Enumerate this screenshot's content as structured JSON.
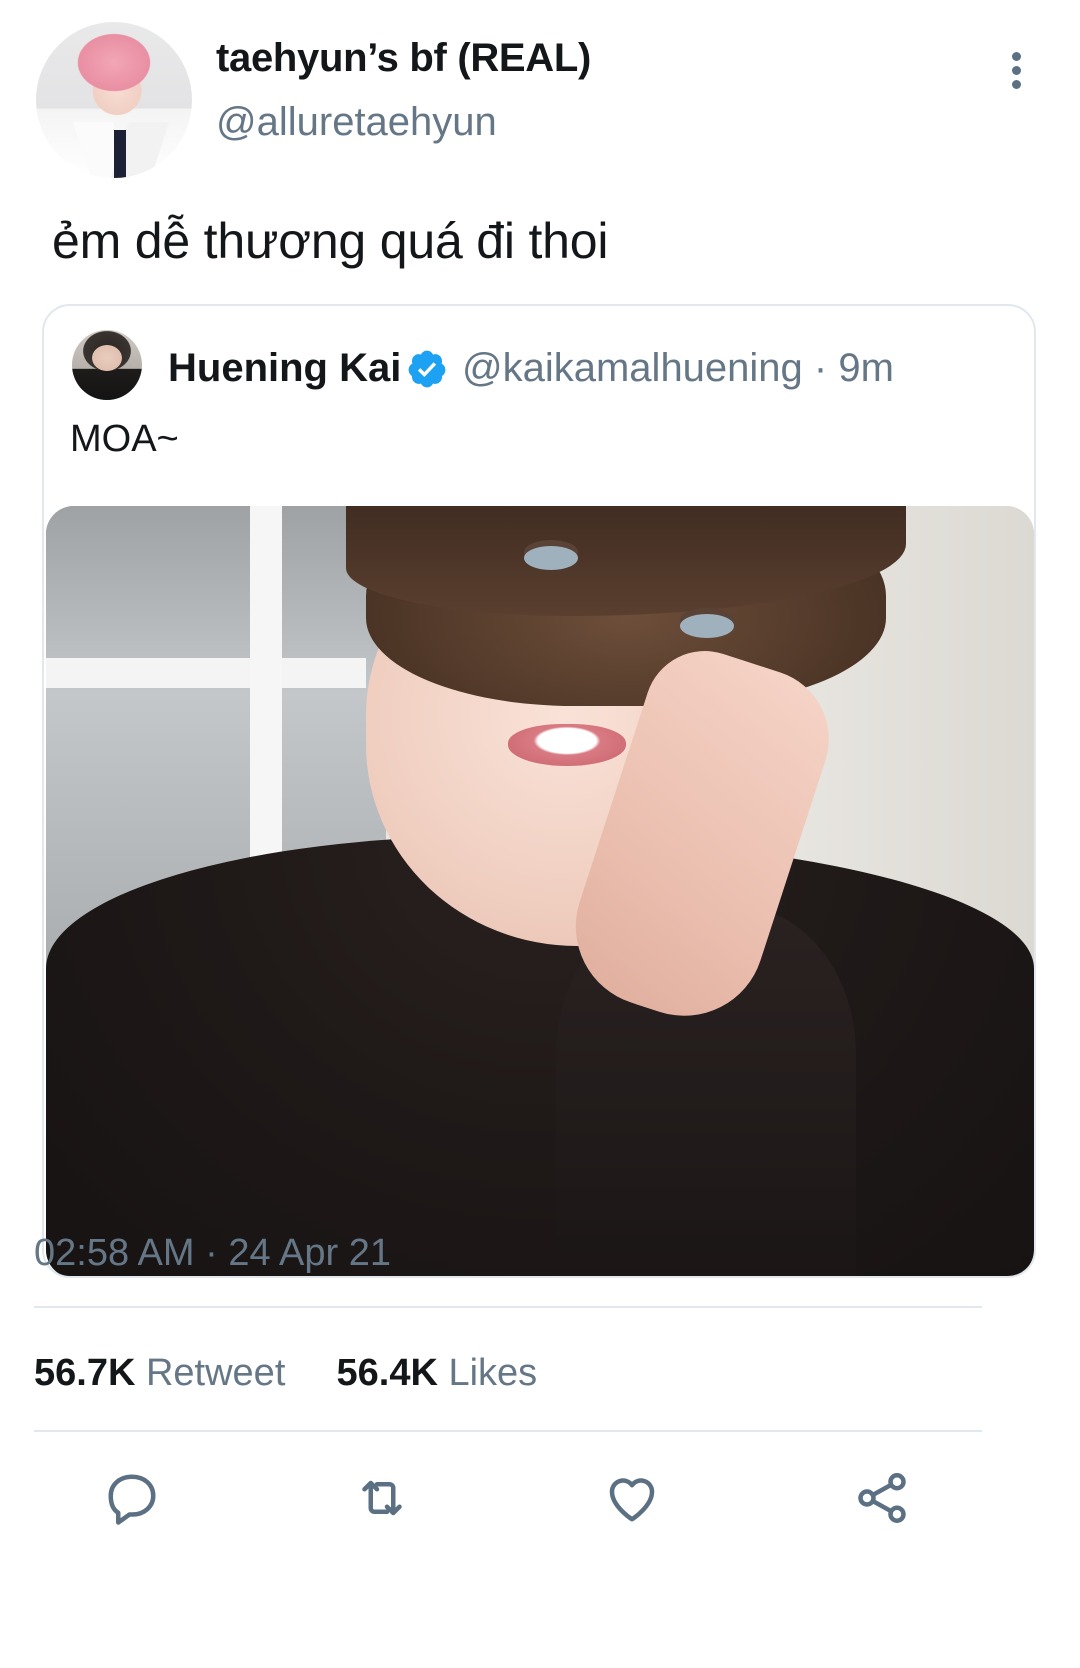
{
  "author": {
    "display_name": "taehyun’s bf (REAL)",
    "handle": "@alluretaehyun"
  },
  "tweet": {
    "text": "ẻm dễ thương quá đi thoi",
    "timestamp": "02:58 AM · 24 Apr 21"
  },
  "quoted": {
    "display_name": "Huening Kai",
    "handle_time": "@kaikamalhuening · 9m",
    "text": "MOA~",
    "verified": true
  },
  "stats": {
    "retweets_count": "56.7K",
    "retweets_label": "Retweet",
    "likes_count": "56.4K",
    "likes_label": "Likes"
  },
  "actions": [
    "reply-icon",
    "retweet-icon",
    "like-icon",
    "share-icon"
  ],
  "colors": {
    "text_primary": "#14171a",
    "text_secondary": "#657786",
    "border": "#e1e8ed",
    "verified": "#1da1f2",
    "icon": "#5b7083"
  }
}
